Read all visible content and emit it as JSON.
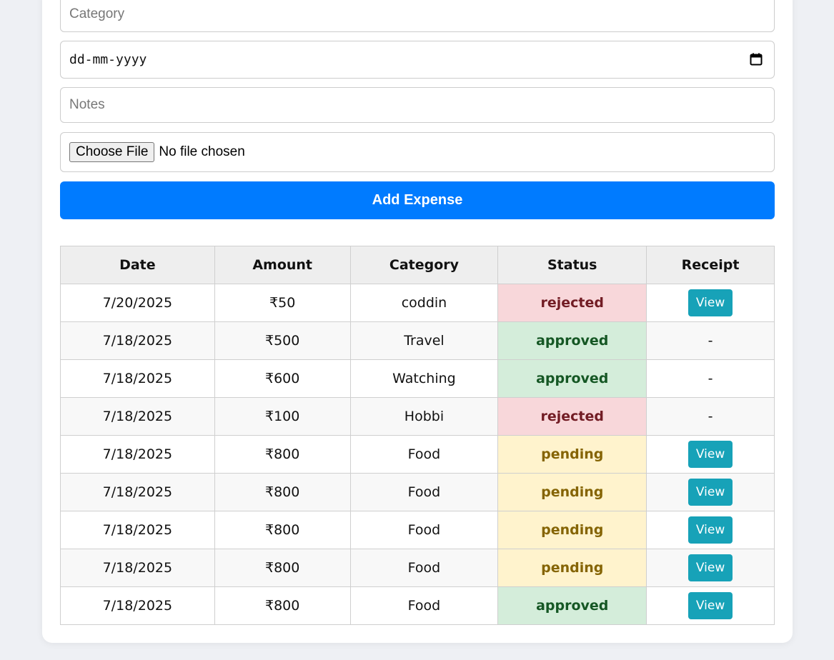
{
  "form": {
    "category_placeholder": "Category",
    "date_placeholder": "dd-mm-yyyy",
    "notes_placeholder": "Notes",
    "file_button_label": "Choose File",
    "file_status": "No file chosen",
    "submit_label": "Add Expense"
  },
  "table": {
    "headers": [
      "Date",
      "Amount",
      "Category",
      "Status",
      "Receipt"
    ],
    "rows": [
      {
        "date": "7/20/2025",
        "amount": "₹50",
        "category": "coddin",
        "status": "rejected",
        "receipt": "View"
      },
      {
        "date": "7/18/2025",
        "amount": "₹500",
        "category": "Travel",
        "status": "approved",
        "receipt": "-"
      },
      {
        "date": "7/18/2025",
        "amount": "₹600",
        "category": "Watching",
        "status": "approved",
        "receipt": "-"
      },
      {
        "date": "7/18/2025",
        "amount": "₹100",
        "category": "Hobbi",
        "status": "rejected",
        "receipt": "-"
      },
      {
        "date": "7/18/2025",
        "amount": "₹800",
        "category": "Food",
        "status": "pending",
        "receipt": "View"
      },
      {
        "date": "7/18/2025",
        "amount": "₹800",
        "category": "Food",
        "status": "pending",
        "receipt": "View"
      },
      {
        "date": "7/18/2025",
        "amount": "₹800",
        "category": "Food",
        "status": "pending",
        "receipt": "View"
      },
      {
        "date": "7/18/2025",
        "amount": "₹800",
        "category": "Food",
        "status": "pending",
        "receipt": "View"
      },
      {
        "date": "7/18/2025",
        "amount": "₹800",
        "category": "Food",
        "status": "approved",
        "receipt": "View"
      }
    ]
  },
  "colors": {
    "primary": "#007bff",
    "info": "#17a2b8",
    "rejected_bg": "#f8d7da",
    "approved_bg": "#d4edda",
    "pending_bg": "#fff3cd"
  },
  "icons": {
    "date_picker": "calendar-icon"
  }
}
